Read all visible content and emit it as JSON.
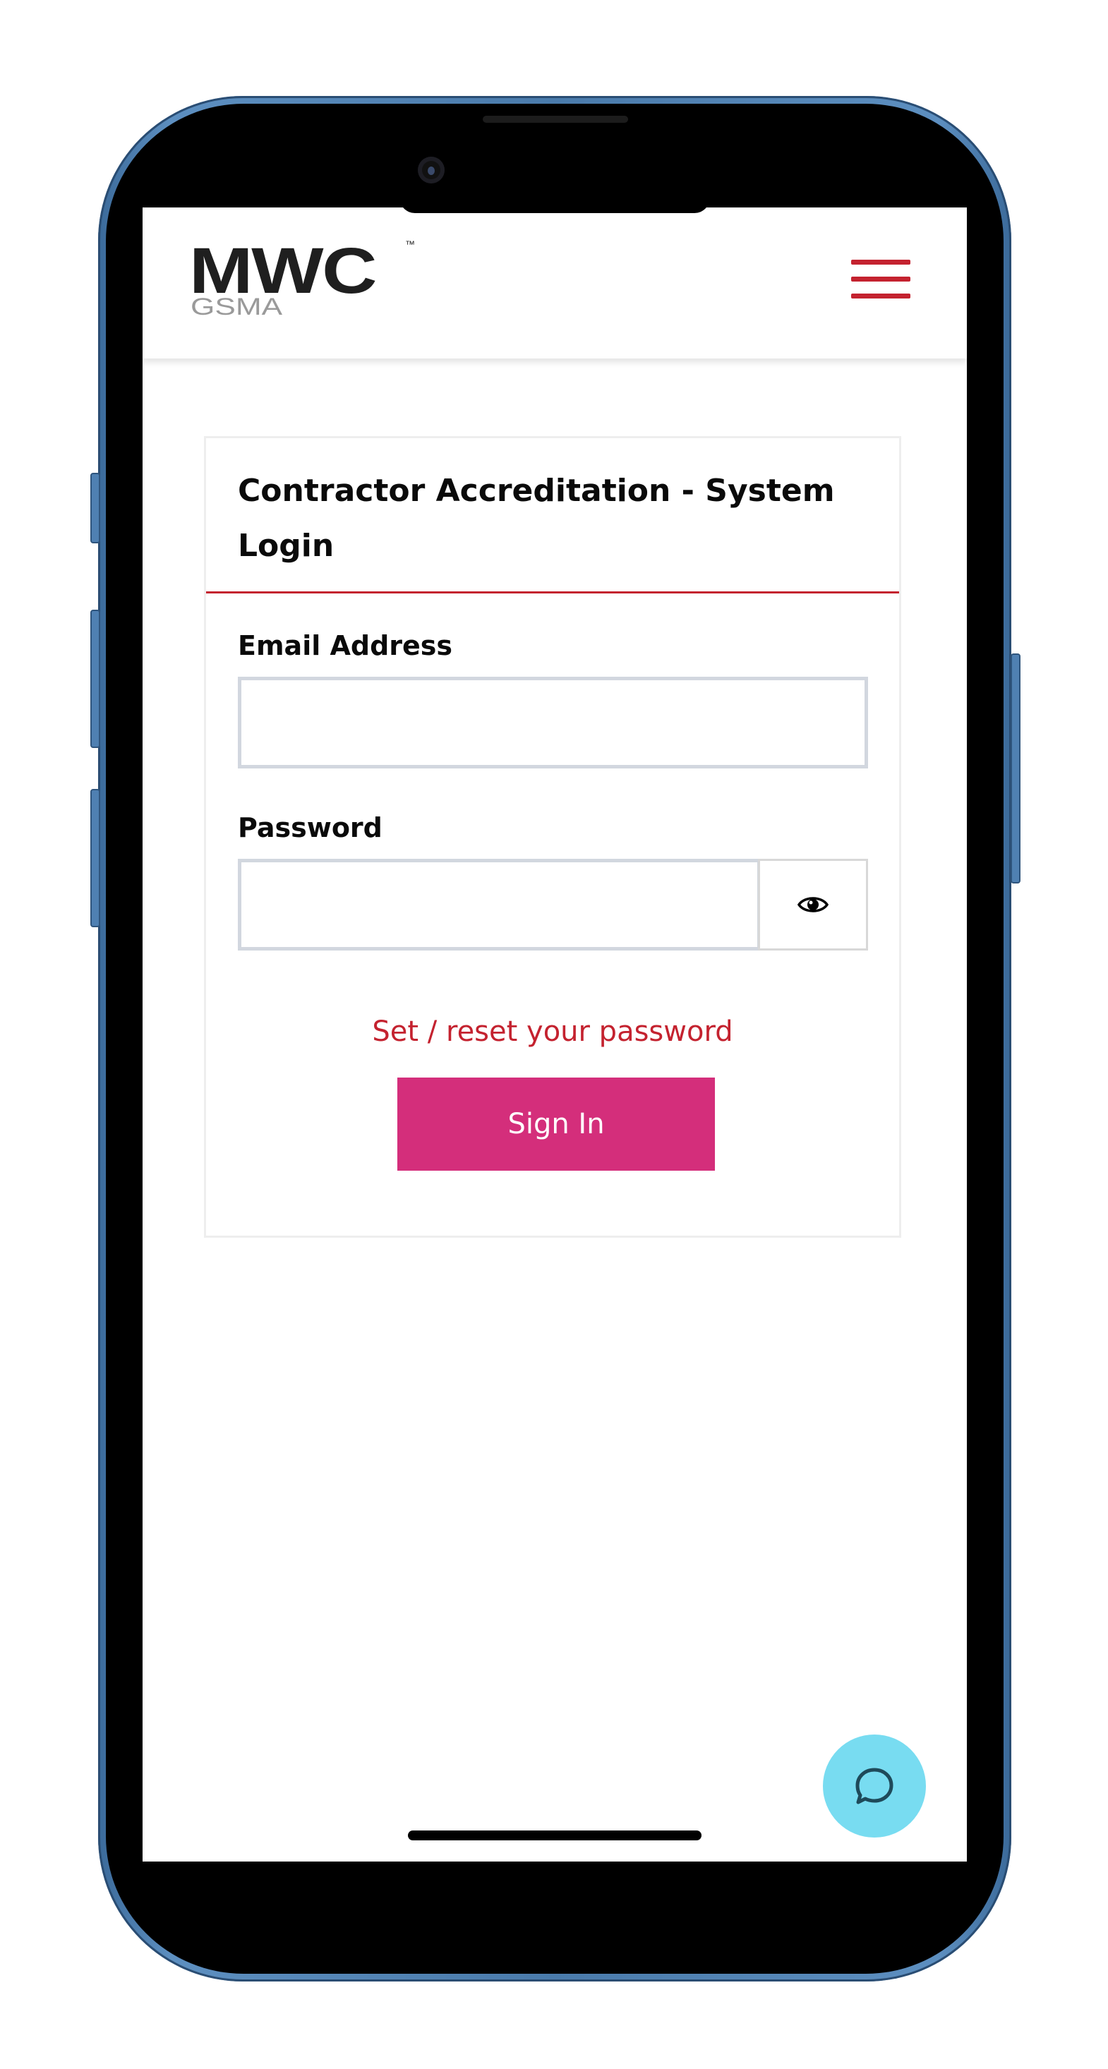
{
  "header": {
    "logo_main": "MWC",
    "logo_trademark": "™",
    "logo_sub": "GSMA",
    "menu_icon": "hamburger-menu-icon"
  },
  "login": {
    "title": "Contractor Accreditation - System Login",
    "email_label": "Email Address",
    "email_value": "",
    "password_label": "Password",
    "password_value": "",
    "show_password_icon": "eye-icon",
    "reset_link": "Set / reset your password",
    "sign_in_label": "Sign In"
  },
  "chat": {
    "icon": "chat-bubble-icon"
  },
  "colors": {
    "brand_red": "#c4222f",
    "sign_in_pink": "#d42e7b",
    "chat_cyan": "#78dcf1",
    "phone_frame_blue": "#4a7bab"
  }
}
